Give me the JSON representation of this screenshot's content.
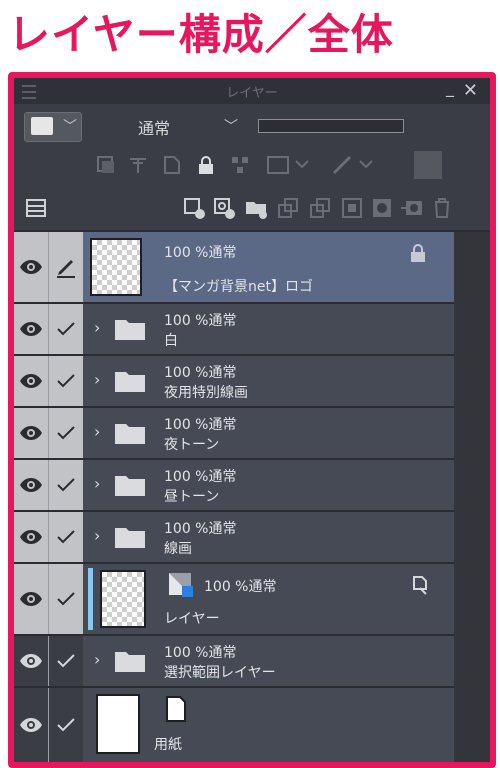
{
  "page": {
    "title": "レイヤー構成／全体"
  },
  "panel": {
    "title": "レイヤー",
    "blend_mode": "通常",
    "minimize": "_",
    "close": "✕"
  },
  "layers": [
    {
      "id": "logo",
      "opacity_mode": "100 %通常",
      "name": "【マンガ背景net】ロゴ",
      "type": "raster",
      "selected": true,
      "locked": true,
      "edit_icon": "pen-icon"
    },
    {
      "id": "white",
      "opacity_mode": "100 %通常",
      "name": "白",
      "type": "folder"
    },
    {
      "id": "night-lines",
      "opacity_mode": "100 %通常",
      "name": "夜用特別線画",
      "type": "folder"
    },
    {
      "id": "night-tone",
      "opacity_mode": "100 %通常",
      "name": "夜トーン",
      "type": "folder"
    },
    {
      "id": "day-tone",
      "opacity_mode": "100 %通常",
      "name": "昼トーン",
      "type": "folder"
    },
    {
      "id": "lines",
      "opacity_mode": "100 %通常",
      "name": "線画",
      "type": "folder"
    },
    {
      "id": "layer",
      "opacity_mode": "100 %通常",
      "name": "レイヤー",
      "type": "raster-mask",
      "accent_color": "#8ac7f0"
    },
    {
      "id": "selection",
      "opacity_mode": "100 %通常",
      "name": "選択範囲レイヤー",
      "type": "folder",
      "dark": true
    },
    {
      "id": "paper",
      "opacity_mode": "",
      "name": "用紙",
      "type": "paper",
      "dark": true
    }
  ],
  "colors": {
    "accent": "#e8175d",
    "selected_row": "#5b6987",
    "row": "#464a55"
  }
}
